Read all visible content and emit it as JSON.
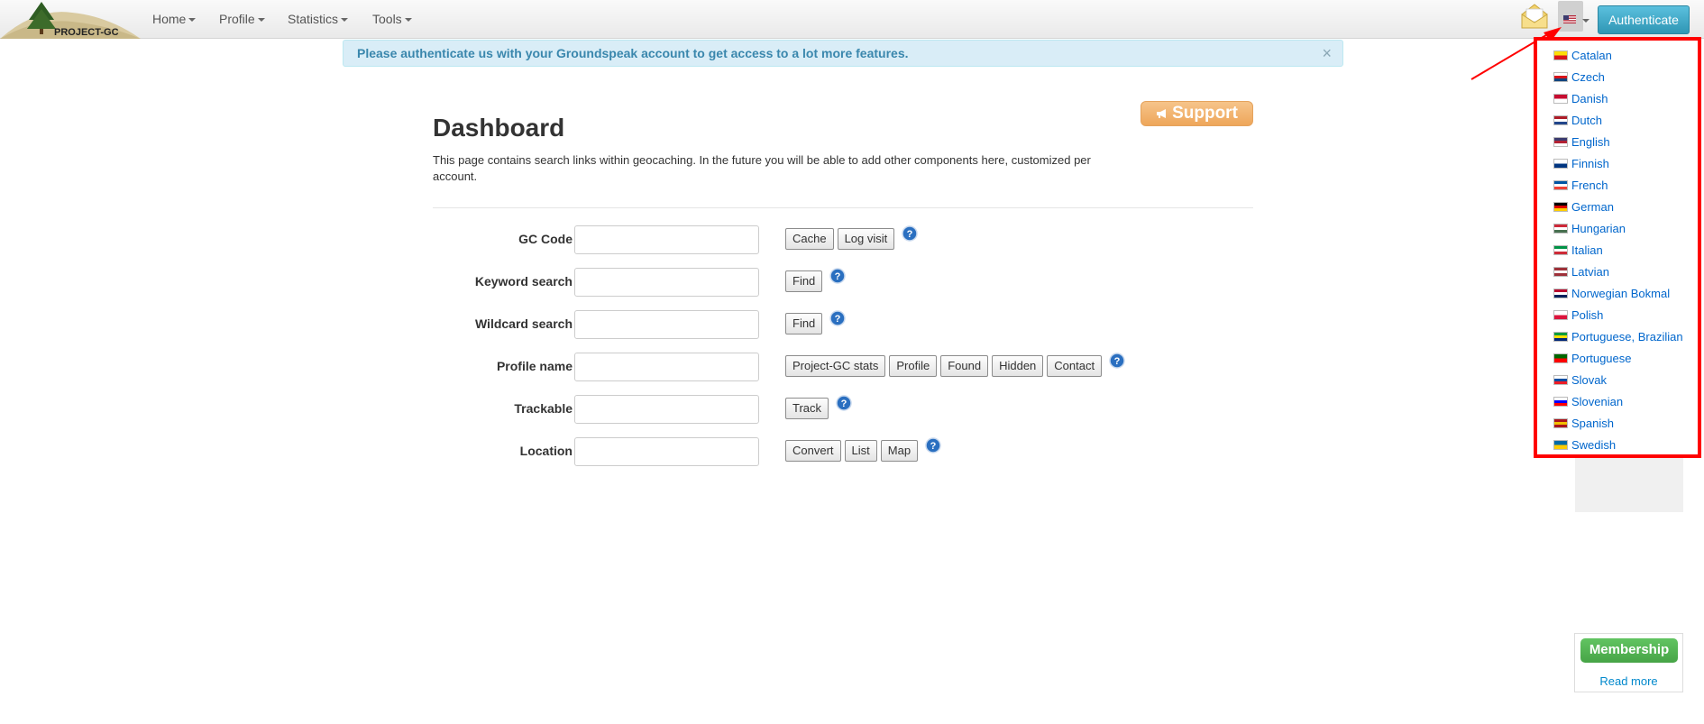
{
  "navbar": {
    "logo_text": "PROJECT-GC",
    "menu": [
      {
        "label": "Home"
      },
      {
        "label": "Profile"
      },
      {
        "label": "Statistics"
      },
      {
        "label": "Tools"
      }
    ],
    "authenticate_label": "Authenticate"
  },
  "alert": {
    "message": "Please authenticate us with your Groundspeak account to get access to a lot more features.",
    "close": "×"
  },
  "main": {
    "support_label": "Support",
    "title": "Dashboard",
    "description": "This page contains search links within geocaching. In the future you will be able to add other components here, customized per account.",
    "rows": [
      {
        "label": "GC Code",
        "buttons": [
          "Cache",
          "Log visit"
        ]
      },
      {
        "label": "Keyword search",
        "buttons": [
          "Find"
        ]
      },
      {
        "label": "Wildcard search",
        "buttons": [
          "Find"
        ]
      },
      {
        "label": "Profile name",
        "buttons": [
          "Project-GC stats",
          "Profile",
          "Found",
          "Hidden",
          "Contact"
        ]
      },
      {
        "label": "Trackable",
        "buttons": [
          "Track"
        ]
      },
      {
        "label": "Location",
        "buttons": [
          "Convert",
          "List",
          "Map"
        ]
      }
    ]
  },
  "language_menu": {
    "items": [
      {
        "label": "Catalan",
        "colors": [
          "#fcdd09",
          "#da121a"
        ]
      },
      {
        "label": "Czech",
        "colors": [
          "#ffffff",
          "#d7141a",
          "#11457e"
        ]
      },
      {
        "label": "Danish",
        "colors": [
          "#c60c30",
          "#ffffff"
        ]
      },
      {
        "label": "Dutch",
        "colors": [
          "#ae1c28",
          "#ffffff",
          "#21468b"
        ]
      },
      {
        "label": "English",
        "colors": [
          "#3c3b6e",
          "#b22234",
          "#ffffff"
        ]
      },
      {
        "label": "Finnish",
        "colors": [
          "#ffffff",
          "#003580"
        ]
      },
      {
        "label": "French",
        "colors": [
          "#0055a4",
          "#ffffff",
          "#ef4135"
        ]
      },
      {
        "label": "German",
        "colors": [
          "#000000",
          "#dd0000",
          "#ffce00"
        ]
      },
      {
        "label": "Hungarian",
        "colors": [
          "#ce2939",
          "#ffffff",
          "#477050"
        ]
      },
      {
        "label": "Italian",
        "colors": [
          "#009246",
          "#ffffff",
          "#ce2b37"
        ]
      },
      {
        "label": "Latvian",
        "colors": [
          "#9e3039",
          "#ffffff",
          "#9e3039"
        ]
      },
      {
        "label": "Norwegian Bokmal",
        "colors": [
          "#ba0c2f",
          "#ffffff",
          "#00205b"
        ]
      },
      {
        "label": "Polish",
        "colors": [
          "#ffffff",
          "#dc143c"
        ]
      },
      {
        "label": "Portuguese, Brazilian",
        "colors": [
          "#009c3b",
          "#ffdf00",
          "#002776"
        ]
      },
      {
        "label": "Portuguese",
        "colors": [
          "#006600",
          "#ff0000"
        ]
      },
      {
        "label": "Slovak",
        "colors": [
          "#ffffff",
          "#0b4ea2",
          "#ee1c25"
        ]
      },
      {
        "label": "Slovenian",
        "colors": [
          "#ffffff",
          "#0000ff",
          "#ff0000"
        ]
      },
      {
        "label": "Spanish",
        "colors": [
          "#aa151b",
          "#f1bf00",
          "#aa151b"
        ]
      },
      {
        "label": "Swedish",
        "colors": [
          "#006aa7",
          "#fecc00"
        ]
      }
    ]
  },
  "membership": {
    "button_label": "Membership",
    "read_more": "Read more"
  }
}
